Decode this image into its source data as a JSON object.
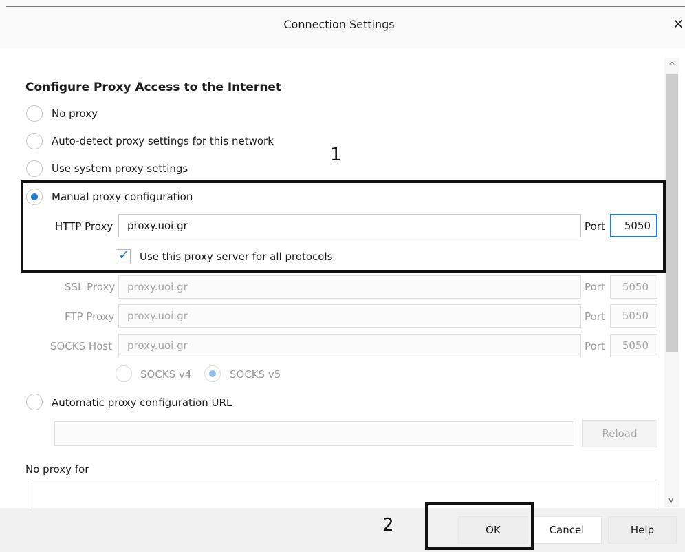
{
  "dialog": {
    "title": "Connection Settings",
    "close_glyph": "×"
  },
  "section_title": "Configure Proxy Access to the Internet",
  "options": {
    "no_proxy": "No proxy",
    "auto_detect": "Auto-detect proxy settings for this network",
    "system": "Use system proxy settings",
    "manual": "Manual proxy configuration",
    "auto_url": "Automatic proxy configuration URL"
  },
  "http_proxy": {
    "label": "HTTP Proxy",
    "value": "proxy.uoi.gr",
    "port_label": "Port",
    "port_value": "5050"
  },
  "use_for_all": {
    "label": "Use this proxy server for all protocols",
    "checked": true
  },
  "ssl_proxy": {
    "label": "SSL Proxy",
    "value": "proxy.uoi.gr",
    "port_label": "Port",
    "port_value": "5050"
  },
  "ftp_proxy": {
    "label": "FTP Proxy",
    "value": "proxy.uoi.gr",
    "port_label": "Port",
    "port_value": "5050"
  },
  "socks_host": {
    "label": "SOCKS Host",
    "value": "proxy.uoi.gr",
    "port_label": "Port",
    "port_value": "5050"
  },
  "socks_version": {
    "v4": "SOCKS v4",
    "v5": "SOCKS v5"
  },
  "auto_url_field": {
    "value": ""
  },
  "reload_label": "Reload",
  "no_proxy_for": {
    "label": "No proxy for",
    "value": ""
  },
  "buttons": {
    "ok": "OK",
    "cancel": "Cancel",
    "help": "Help"
  },
  "annotations": {
    "one": "1",
    "two": "2"
  },
  "scroll_glyphs": {
    "up": "^",
    "down": "v"
  },
  "colors": {
    "accent": "#1c7ed6",
    "annotation": "#111111"
  }
}
